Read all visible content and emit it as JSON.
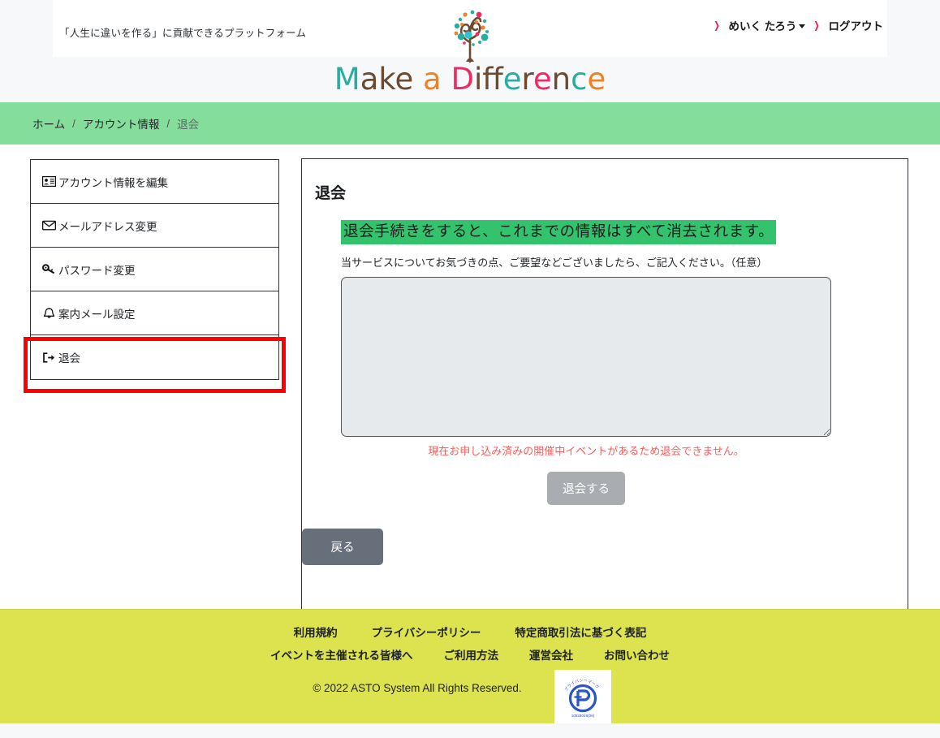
{
  "header": {
    "tagline": "「人生に違いを作る」に貢献できるプラットフォーム",
    "user_name": "めいく たろう",
    "logout_label": "ログアウト",
    "chevron": "❯",
    "logo": {
      "words": [
        {
          "text": "M",
          "color": "#2aada0"
        },
        {
          "text": "ake",
          "color": "#6b4a2f"
        },
        {
          "text": " ",
          "color": "#6b4a2f"
        },
        {
          "text": "a",
          "color": "#f08122"
        },
        {
          "text": " ",
          "color": "#6b4a2f"
        },
        {
          "text": "D",
          "color": "#ec2c62"
        },
        {
          "text": "iff",
          "color": "#6b4a2f"
        },
        {
          "text": "e",
          "color": "#2aada0"
        },
        {
          "text": "r",
          "color": "#6b4a2f"
        },
        {
          "text": "e",
          "color": "#ec2c62"
        },
        {
          "text": "n",
          "color": "#6b4a2f"
        },
        {
          "text": "c",
          "color": "#2aada0"
        },
        {
          "text": "e",
          "color": "#f08122"
        }
      ]
    }
  },
  "breadcrumb": {
    "items": [
      {
        "label": "ホーム",
        "current": false
      },
      {
        "label": "アカウント情報",
        "current": false
      },
      {
        "label": "退会",
        "current": true
      }
    ],
    "separator": "/",
    "bar_color": "#85dd9c"
  },
  "sidebar": {
    "items": [
      {
        "label": "アカウント情報を編集",
        "icon": "id-card-icon",
        "selected": false
      },
      {
        "label": "メールアドレス変更",
        "icon": "envelope-icon",
        "selected": false
      },
      {
        "label": "パスワード変更",
        "icon": "key-icon",
        "selected": false
      },
      {
        "label": "案内メール設定",
        "icon": "bell-icon",
        "selected": false
      },
      {
        "label": "退会",
        "icon": "sign-out-icon",
        "selected": true
      }
    ],
    "highlight_color": "#ff0000"
  },
  "main": {
    "title": "退会",
    "warning": "退会手続きをすると、これまでの情報はすべて消去されます。",
    "warning_highlight_color": "#32c36c",
    "comment_label": "当サービスについてお気づきの点、ご要望などございましたら、ご記入ください。（任意）",
    "comment_value": "",
    "comment_placeholder": "",
    "error_message": "現在お申し込み済みの開催中イベントがあるため退会できません。",
    "error_color": "#fd5b5b",
    "submit_label": "退会する",
    "submit_disabled": true,
    "back_label": "戻る"
  },
  "footer": {
    "background_color": "#dce34e",
    "links_row1": [
      "利用規約",
      "プライバシーポリシー",
      "特定商取引法に基づく表記"
    ],
    "links_row2": [
      "イベントを主催される皆様へ",
      "ご利用方法",
      "運営会社",
      "お問い合わせ"
    ],
    "copyright": "© 2022 ASTO System All Rights Reserved.",
    "privacy_mark": {
      "icon": "privacy-mark-icon",
      "top_text": "プライバシーマーク",
      "number": "10823046(06)"
    }
  }
}
